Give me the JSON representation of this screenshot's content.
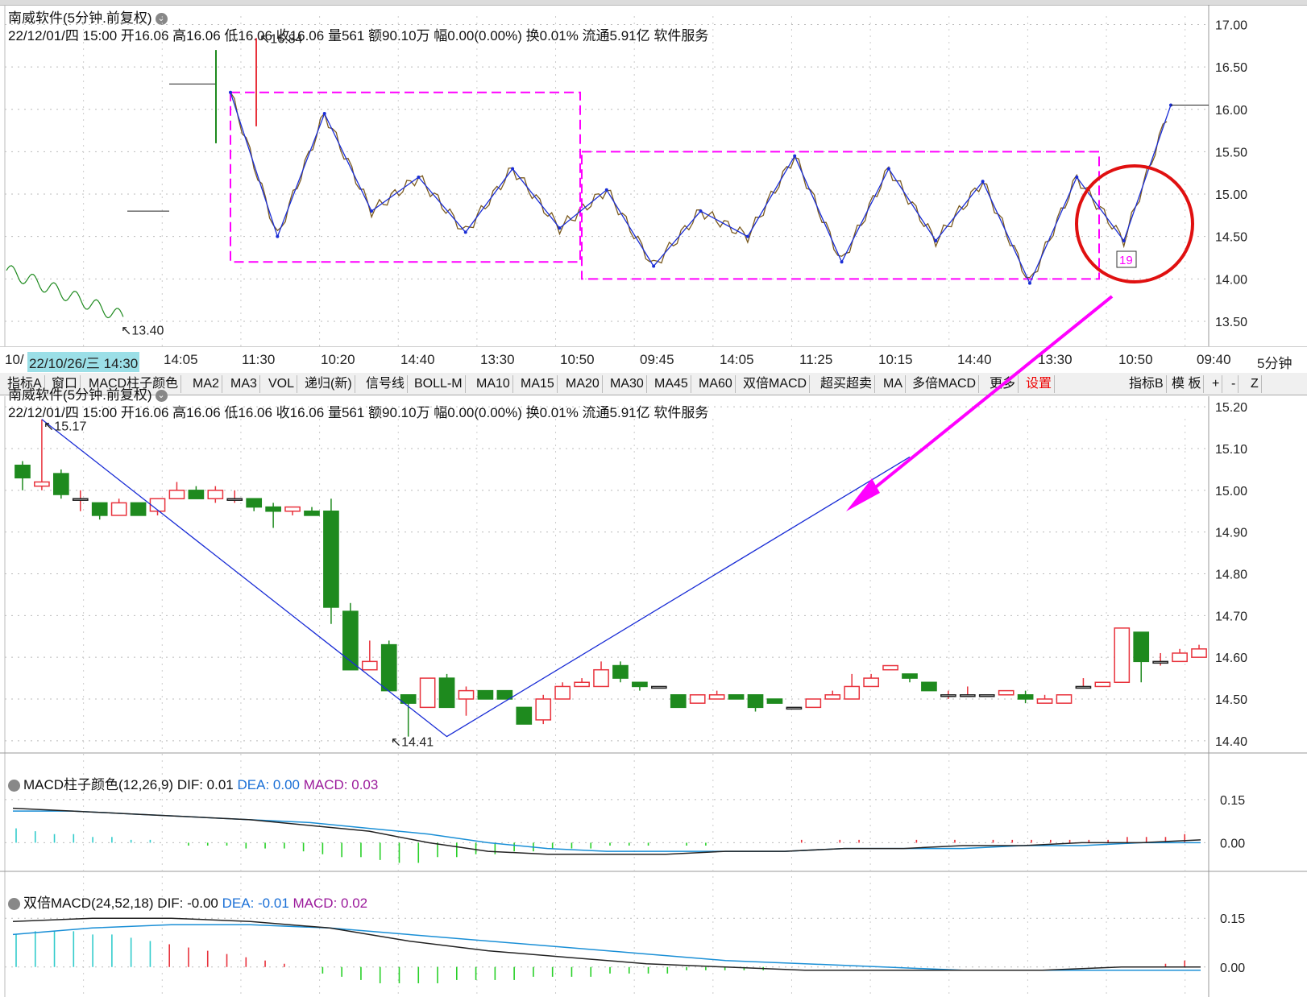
{
  "top_pane": {
    "title": "南威软件(5分钟.前复权)",
    "info": "22/12/01/四 15:00 开16.06 高16.06 低16.06 收16.06 量561 额90.10万 幅0.00(0.00%) 换0.01% 流通5.91亿 软件服务",
    "y_ticks": [
      "17.00",
      "16.50",
      "16.00",
      "15.50",
      "15.00",
      "14.50",
      "14.00",
      "13.50"
    ],
    "hi_label": "16.84",
    "lo_label": "13.40",
    "circle_label": "19"
  },
  "time_axis": {
    "labels": [
      "10/",
      "22/10/26/三 14:30",
      "14:05",
      "11:30",
      "10:20",
      "14:40",
      "13:30",
      "10:50",
      "09:45",
      "14:05",
      "11:25",
      "10:15",
      "14:40",
      "13:30",
      "10:50",
      "09:40"
    ],
    "period": "5分钟"
  },
  "toolbar": {
    "buttons": [
      "指标A",
      "窗口",
      "MACD柱子颜色",
      "MA2",
      "MA3",
      "VOL",
      "递归(新)",
      "信号线",
      "BOLL-M",
      "MA10",
      "MA15",
      "MA20",
      "MA30",
      "MA45",
      "MA60",
      "双倍MACD",
      "超买超卖",
      "MA",
      "多倍MACD",
      "更多",
      "设置"
    ],
    "right_buttons": [
      "指标B",
      "模 板",
      "+",
      "-",
      "Z"
    ]
  },
  "main_pane": {
    "title": "南威软件(5分钟.前复权)",
    "info": "22/12/01/四 15:00 开16.06 高16.06 低16.06 收16.06 量561 额90.10万 幅0.00(0.00%) 换0.01% 流通5.91亿 软件服务",
    "y_ticks": [
      "15.20",
      "15.10",
      "15.00",
      "14.90",
      "14.80",
      "14.70",
      "14.60",
      "14.50",
      "14.40"
    ],
    "hi_label": "15.17",
    "lo_label": "14.41"
  },
  "macd_pane": {
    "name": "MACD柱子颜色(12,26,9)",
    "dif": "DIF: 0.01",
    "dea": "DEA: 0.00",
    "macd": "MACD: 0.03",
    "y_ticks": [
      "0.15",
      "0.00"
    ]
  },
  "dmacd_pane": {
    "name": "双倍MACD(24,52,18)",
    "dif": "DIF: -0.00",
    "dea": "DEA: -0.01",
    "macd": "MACD: 0.02",
    "y_ticks": [
      "0.15",
      "0.00"
    ]
  },
  "colors": {
    "up": "#e8323c",
    "down": "#1e8a1e",
    "zig": "#1a2dd6",
    "box": "#ff00ff",
    "circle": "#e01010",
    "dea": "#1a8fd6"
  },
  "chart_data": [
    {
      "type": "candlestick",
      "title": "南威软件(5分钟.前复权)",
      "y_range": [
        13.3,
        17.1
      ],
      "zigzag": [
        16.2,
        14.5,
        15.95,
        14.8,
        15.2,
        14.55,
        15.3,
        14.6,
        15.05,
        14.15,
        14.8,
        14.5,
        15.45,
        14.2,
        15.3,
        14.45,
        15.15,
        13.95,
        15.2,
        14.45,
        16.05
      ],
      "box1": [
        14.2,
        16.2
      ],
      "box2": [
        14.0,
        15.5
      ],
      "prior_segments": [
        13.4,
        14.8,
        16.3
      ],
      "high": 16.84,
      "low": 13.4
    },
    {
      "type": "candlestick",
      "title": "南威软件(5分钟.前复权)",
      "y_range": [
        14.39,
        15.21
      ],
      "candles": [
        [
          15.06,
          15.03,
          15.07,
          15.0
        ],
        [
          15.01,
          15.02,
          15.17,
          15.0
        ],
        [
          15.04,
          14.99,
          15.05,
          14.98
        ],
        [
          14.98,
          14.98,
          15.0,
          14.95
        ],
        [
          14.97,
          14.94,
          14.97,
          14.93
        ],
        [
          14.94,
          14.97,
          14.98,
          14.94
        ],
        [
          14.97,
          14.94,
          14.97,
          14.94
        ],
        [
          14.95,
          14.98,
          14.98,
          14.94
        ],
        [
          14.98,
          15.0,
          15.02,
          14.98
        ],
        [
          15.0,
          14.98,
          15.01,
          14.98
        ],
        [
          14.98,
          15.0,
          15.01,
          14.97
        ],
        [
          14.98,
          14.98,
          15.0,
          14.97
        ],
        [
          14.98,
          14.96,
          14.98,
          14.95
        ],
        [
          14.96,
          14.95,
          14.97,
          14.91
        ],
        [
          14.95,
          14.96,
          14.96,
          14.94
        ],
        [
          14.95,
          14.94,
          14.96,
          14.94
        ],
        [
          14.95,
          14.72,
          14.98,
          14.68
        ],
        [
          14.71,
          14.57,
          14.73,
          14.57
        ],
        [
          14.57,
          14.59,
          14.64,
          14.57
        ],
        [
          14.63,
          14.52,
          14.64,
          14.52
        ],
        [
          14.51,
          14.49,
          14.51,
          14.41
        ],
        [
          14.48,
          14.55,
          14.55,
          14.48
        ],
        [
          14.55,
          14.48,
          14.56,
          14.48
        ],
        [
          14.5,
          14.52,
          14.53,
          14.46
        ],
        [
          14.52,
          14.5,
          14.52,
          14.5
        ],
        [
          14.52,
          14.5,
          14.52,
          14.5
        ],
        [
          14.48,
          14.44,
          14.48,
          14.44
        ],
        [
          14.45,
          14.5,
          14.51,
          14.44
        ],
        [
          14.5,
          14.53,
          14.54,
          14.5
        ],
        [
          14.53,
          14.54,
          14.55,
          14.53
        ],
        [
          14.53,
          14.57,
          14.59,
          14.53
        ],
        [
          14.58,
          14.55,
          14.59,
          14.54
        ],
        [
          14.54,
          14.53,
          14.54,
          14.52
        ],
        [
          14.53,
          14.53,
          14.53,
          14.53
        ],
        [
          14.51,
          14.48,
          14.51,
          14.48
        ],
        [
          14.49,
          14.51,
          14.51,
          14.49
        ],
        [
          14.5,
          14.51,
          14.52,
          14.5
        ],
        [
          14.51,
          14.5,
          14.51,
          14.5
        ],
        [
          14.51,
          14.48,
          14.51,
          14.47
        ],
        [
          14.5,
          14.49,
          14.5,
          14.49
        ],
        [
          14.48,
          14.48,
          14.48,
          14.48
        ],
        [
          14.48,
          14.5,
          14.5,
          14.48
        ],
        [
          14.5,
          14.51,
          14.52,
          14.5
        ],
        [
          14.5,
          14.53,
          14.56,
          14.5
        ],
        [
          14.53,
          14.55,
          14.56,
          14.53
        ],
        [
          14.57,
          14.58,
          14.58,
          14.57
        ],
        [
          14.56,
          14.55,
          14.56,
          14.54
        ],
        [
          14.54,
          14.52,
          14.54,
          14.52
        ],
        [
          14.51,
          14.51,
          14.52,
          14.5
        ],
        [
          14.51,
          14.51,
          14.53,
          14.51
        ],
        [
          14.51,
          14.51,
          14.51,
          14.51
        ],
        [
          14.51,
          14.52,
          14.52,
          14.51
        ],
        [
          14.51,
          14.5,
          14.52,
          14.49
        ],
        [
          14.49,
          14.5,
          14.51,
          14.49
        ],
        [
          14.49,
          14.51,
          14.51,
          14.49
        ],
        [
          14.53,
          14.53,
          14.55,
          14.53
        ],
        [
          14.53,
          14.54,
          14.54,
          14.53
        ],
        [
          14.54,
          14.67,
          14.67,
          14.54
        ],
        [
          14.66,
          14.59,
          14.66,
          14.54
        ],
        [
          14.59,
          14.59,
          14.61,
          14.58
        ],
        [
          14.59,
          14.61,
          14.62,
          14.59
        ],
        [
          14.6,
          14.62,
          14.63,
          14.6
        ]
      ],
      "zigzag": [
        [
          1,
          15.17
        ],
        [
          22,
          14.41
        ],
        [
          46,
          15.08
        ]
      ],
      "high": 15.17,
      "low": 14.41
    },
    {
      "type": "line",
      "title": "MACD柱子颜色(12,26,9)",
      "y_range": [
        -0.08,
        0.2
      ],
      "dif": [
        0.12,
        0.11,
        0.1,
        0.09,
        0.08,
        0.06,
        0.04,
        0.0,
        -0.03,
        -0.04,
        -0.04,
        -0.04,
        -0.03,
        -0.03,
        -0.02,
        -0.02,
        -0.01,
        -0.01,
        0.0,
        0.0,
        0.01
      ],
      "dea": [
        0.11,
        0.11,
        0.1,
        0.09,
        0.08,
        0.07,
        0.05,
        0.03,
        0.0,
        -0.02,
        -0.03,
        -0.03,
        -0.03,
        -0.03,
        -0.02,
        -0.02,
        -0.02,
        -0.01,
        -0.01,
        0.0,
        0.0
      ],
      "hist": [
        0.05,
        0.04,
        0.03,
        0.03,
        0.02,
        0.02,
        0.01,
        0.01,
        0.0,
        -0.01,
        -0.01,
        -0.01,
        -0.02,
        -0.02,
        -0.02,
        -0.03,
        -0.04,
        -0.05,
        -0.05,
        -0.06,
        -0.07,
        -0.07,
        -0.05,
        -0.05,
        -0.04,
        -0.04,
        -0.03,
        -0.03,
        -0.02,
        -0.02,
        -0.02,
        -0.01,
        -0.01,
        -0.01,
        0.0,
        -0.01,
        -0.01,
        0.0,
        0.0,
        0.0,
        0.0,
        0.01,
        0.0,
        0.01,
        0.01,
        0.0,
        0.0,
        0.01,
        0.0,
        0.01,
        0.0,
        0.01,
        0.01,
        0.01,
        0.01,
        0.01,
        0.01,
        0.01,
        0.02,
        0.02,
        0.02,
        0.03
      ]
    },
    {
      "type": "line",
      "title": "双倍MACD(24,52,18)",
      "y_range": [
        -0.06,
        0.2
      ],
      "dif": [
        0.14,
        0.15,
        0.15,
        0.14,
        0.12,
        0.08,
        0.05,
        0.03,
        0.01,
        0.0,
        -0.01,
        -0.01,
        -0.01,
        -0.01,
        0.0,
        0.0
      ],
      "dea": [
        0.1,
        0.12,
        0.13,
        0.13,
        0.12,
        0.1,
        0.08,
        0.06,
        0.04,
        0.02,
        0.01,
        0.0,
        -0.01,
        -0.01,
        -0.01,
        -0.01
      ],
      "hist": [
        0.1,
        0.11,
        0.11,
        0.11,
        0.1,
        0.1,
        0.09,
        0.08,
        0.07,
        0.06,
        0.05,
        0.04,
        0.03,
        0.02,
        0.01,
        0.0,
        -0.02,
        -0.03,
        -0.04,
        -0.05,
        -0.05,
        -0.05,
        -0.05,
        -0.04,
        -0.04,
        -0.04,
        -0.04,
        -0.03,
        -0.03,
        -0.03,
        -0.03,
        -0.02,
        -0.02,
        -0.02,
        -0.02,
        -0.01,
        -0.01,
        -0.01,
        -0.01,
        -0.01,
        0.0,
        0.0,
        0.0,
        0.0,
        0.0,
        0.0,
        0.0,
        0.0,
        0.0,
        0.0,
        0.0,
        0.0,
        0.0,
        0.0,
        0.0,
        0.0,
        0.0,
        0.0,
        0.0,
        0.0,
        0.01,
        0.02
      ]
    }
  ]
}
